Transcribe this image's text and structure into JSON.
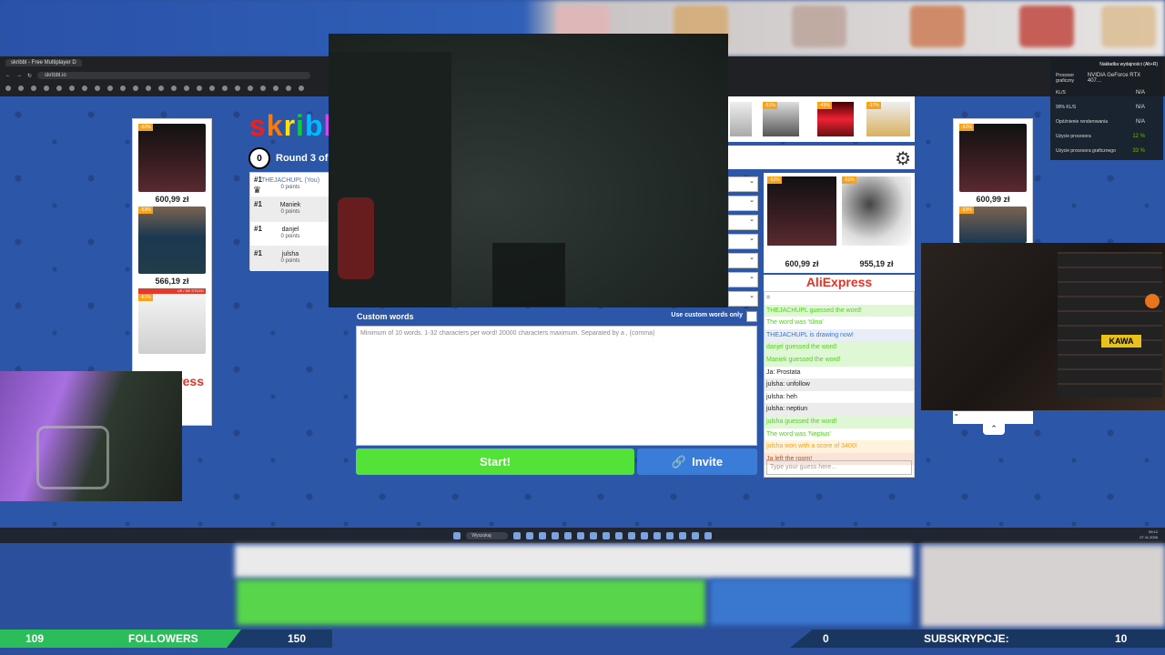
{
  "browser": {
    "tab_title": "skribbl - Free Multiplayer D",
    "url": "skribbl.io"
  },
  "game": {
    "logo": "skribbl",
    "round_text": "Round 3 of",
    "timer": "0",
    "players": [
      {
        "rank": "#1",
        "name": "THEJACHUPL (You)",
        "points": "0 points",
        "is_you": true
      },
      {
        "rank": "#1",
        "name": "Maniek",
        "points": "0 points",
        "is_you": false
      },
      {
        "rank": "#1",
        "name": "danjel",
        "points": "0 points",
        "is_you": false
      },
      {
        "rank": "#1",
        "name": "julsha",
        "points": "0 points",
        "is_you": false
      }
    ],
    "custom_words_label": "Custom words",
    "custom_words_only_label": "Use custom words only",
    "custom_words_placeholder": "Minimum of 10 words. 1-32 characters per word! 20000 characters maximum. Separated by a , (comma)",
    "start_label": "Start!",
    "invite_label": "Invite"
  },
  "ads": {
    "left": [
      {
        "price": "600,99 zł",
        "badge": "-52%"
      },
      {
        "price": "566,19 zł",
        "badge": "-53%"
      },
      {
        "price": "",
        "badge": "-61%"
      }
    ],
    "left_tag": "US / DE STOCK",
    "right_panel": [
      {
        "price": "600,99 zł",
        "badge": "-52%"
      },
      {
        "price": "955,19 zł",
        "badge": "-51%"
      }
    ],
    "brand": "AliExpress",
    "top_strip_badges": [
      "-51%",
      "-49%",
      "-37%"
    ],
    "far_right": [
      {
        "price": "600,99 zł",
        "badge": "-52%"
      },
      {
        "price": "",
        "badge": "-53%"
      }
    ],
    "far_right_input": "="
  },
  "chat": {
    "messages": [
      {
        "text": "=",
        "color": "#555555",
        "bg": "#ffffff"
      },
      {
        "text": "THEJACHUPL guessed the word!",
        "color": "#56ce27",
        "bg": "#e0f7d5"
      },
      {
        "text": "The word was 'ślina'",
        "color": "#56ce27",
        "bg": "#ffffff"
      },
      {
        "text": "THEJACHUPL is drawing now!",
        "color": "#3975ce",
        "bg": "#e8eef8"
      },
      {
        "text": "danjel guessed the word!",
        "color": "#56ce27",
        "bg": "#e0f7d5"
      },
      {
        "text": "Maniek guessed the word!",
        "color": "#56ce27",
        "bg": "#e0f7d5"
      },
      {
        "text": "Ja: Prostata",
        "color": "#222222",
        "bg": "#ffffff"
      },
      {
        "text": "julsha: unfollow",
        "color": "#222222",
        "bg": "#ececec"
      },
      {
        "text": "julsha: heh",
        "color": "#222222",
        "bg": "#ffffff"
      },
      {
        "text": "julsha: neptiun",
        "color": "#222222",
        "bg": "#ececec"
      },
      {
        "text": "julsha guessed the word!",
        "color": "#56ce27",
        "bg": "#e0f7d5"
      },
      {
        "text": "The word was 'Neptun'",
        "color": "#56ce27",
        "bg": "#ffffff"
      },
      {
        "text": "julsha won with a score of 3400!",
        "color": "#f7a21b",
        "bg": "#fff3dd"
      },
      {
        "text": "Ja left the room!",
        "color": "#ce4f0a",
        "bg": "#fbe3d8"
      }
    ],
    "input_placeholder": "Type your guess here..."
  },
  "overlay": {
    "perf_title": "Nakładka wydajności (Alt+R)",
    "perf_rows": [
      {
        "label": "Procesor graficzny",
        "value": "NVIDIA GeForce RTX 407..."
      },
      {
        "label": "KL/S",
        "value": "N/A"
      },
      {
        "label": "99% KL/S",
        "value": "N/A"
      },
      {
        "label": "Opóźnienie renderowania",
        "value": "N/A"
      },
      {
        "label": "Użycie procesora",
        "value": "12 %"
      },
      {
        "label": "Użycie procesora graficznego",
        "value": "33 %"
      }
    ],
    "webcam_sign": "KAWA",
    "followers_current": "109",
    "followers_label": "FOLLOWERS",
    "followers_goal": "150",
    "subs_current": "0",
    "subs_label": "SUBSKRYPCJE:",
    "subs_goal": "10"
  },
  "taskbar": {
    "search_label": "Wyszukaj",
    "time": "09:12",
    "date": "07.11.2026"
  },
  "colors": {
    "start_green": "#53e237",
    "invite_blue": "#3a7dd8",
    "page_blue": "#2c56a8"
  }
}
